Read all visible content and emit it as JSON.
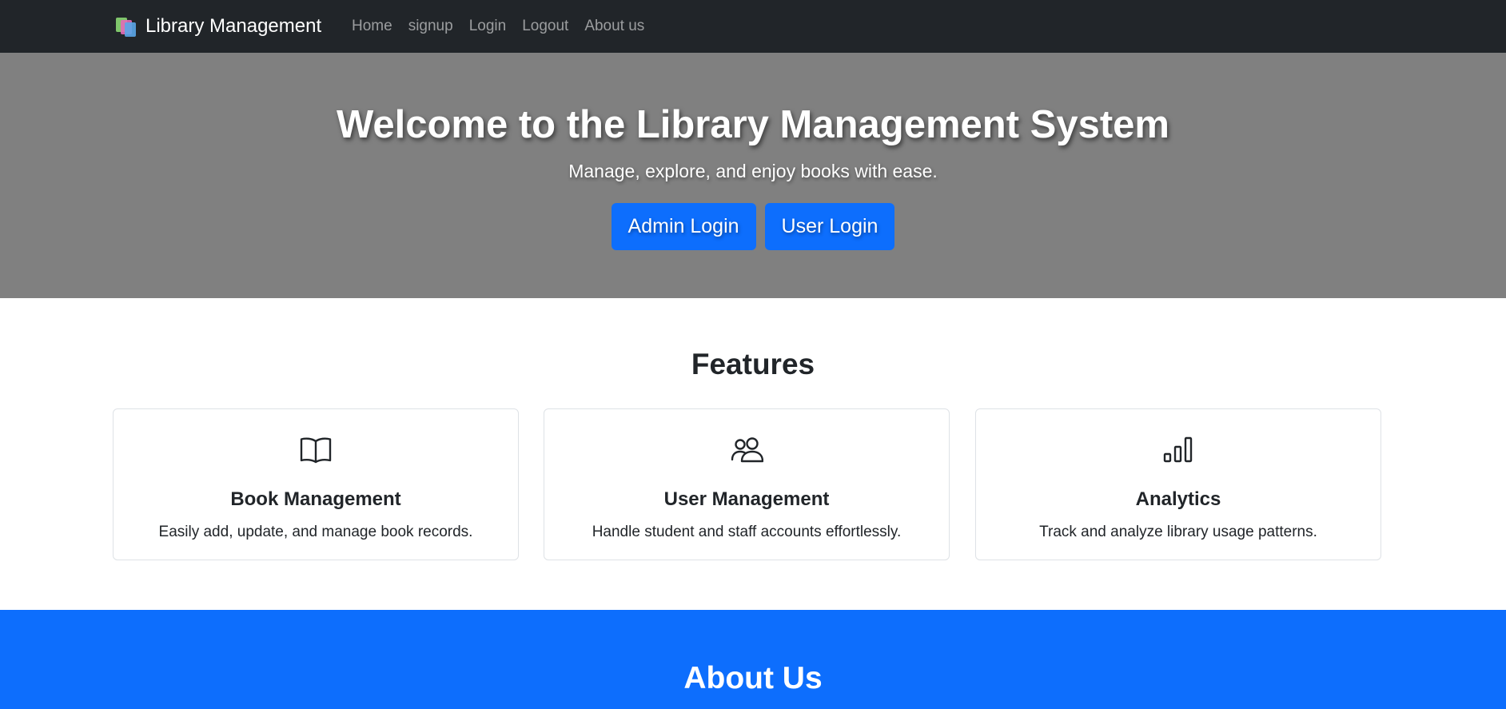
{
  "navbar": {
    "brand": "Library Management",
    "links": [
      "Home",
      "signup",
      "Login",
      "Logout",
      "About us"
    ]
  },
  "hero": {
    "title": "Welcome to the Library Management System",
    "subtitle": "Manage, explore, and enjoy books with ease.",
    "admin_button": "Admin Login",
    "user_button": "User Login"
  },
  "features": {
    "heading": "Features",
    "cards": [
      {
        "icon": "book-open-icon",
        "title": "Book Management",
        "description": "Easily add, update, and manage book records."
      },
      {
        "icon": "people-icon",
        "title": "User Management",
        "description": "Handle student and staff accounts effortlessly."
      },
      {
        "icon": "bar-chart-icon",
        "title": "Analytics",
        "description": "Track and analyze library usage patterns."
      }
    ]
  },
  "about": {
    "heading": "About Us"
  },
  "colors": {
    "navbar_bg": "#212529",
    "hero_bg": "#808080",
    "primary": "#0d6efd",
    "card_border": "#dee2e6"
  }
}
